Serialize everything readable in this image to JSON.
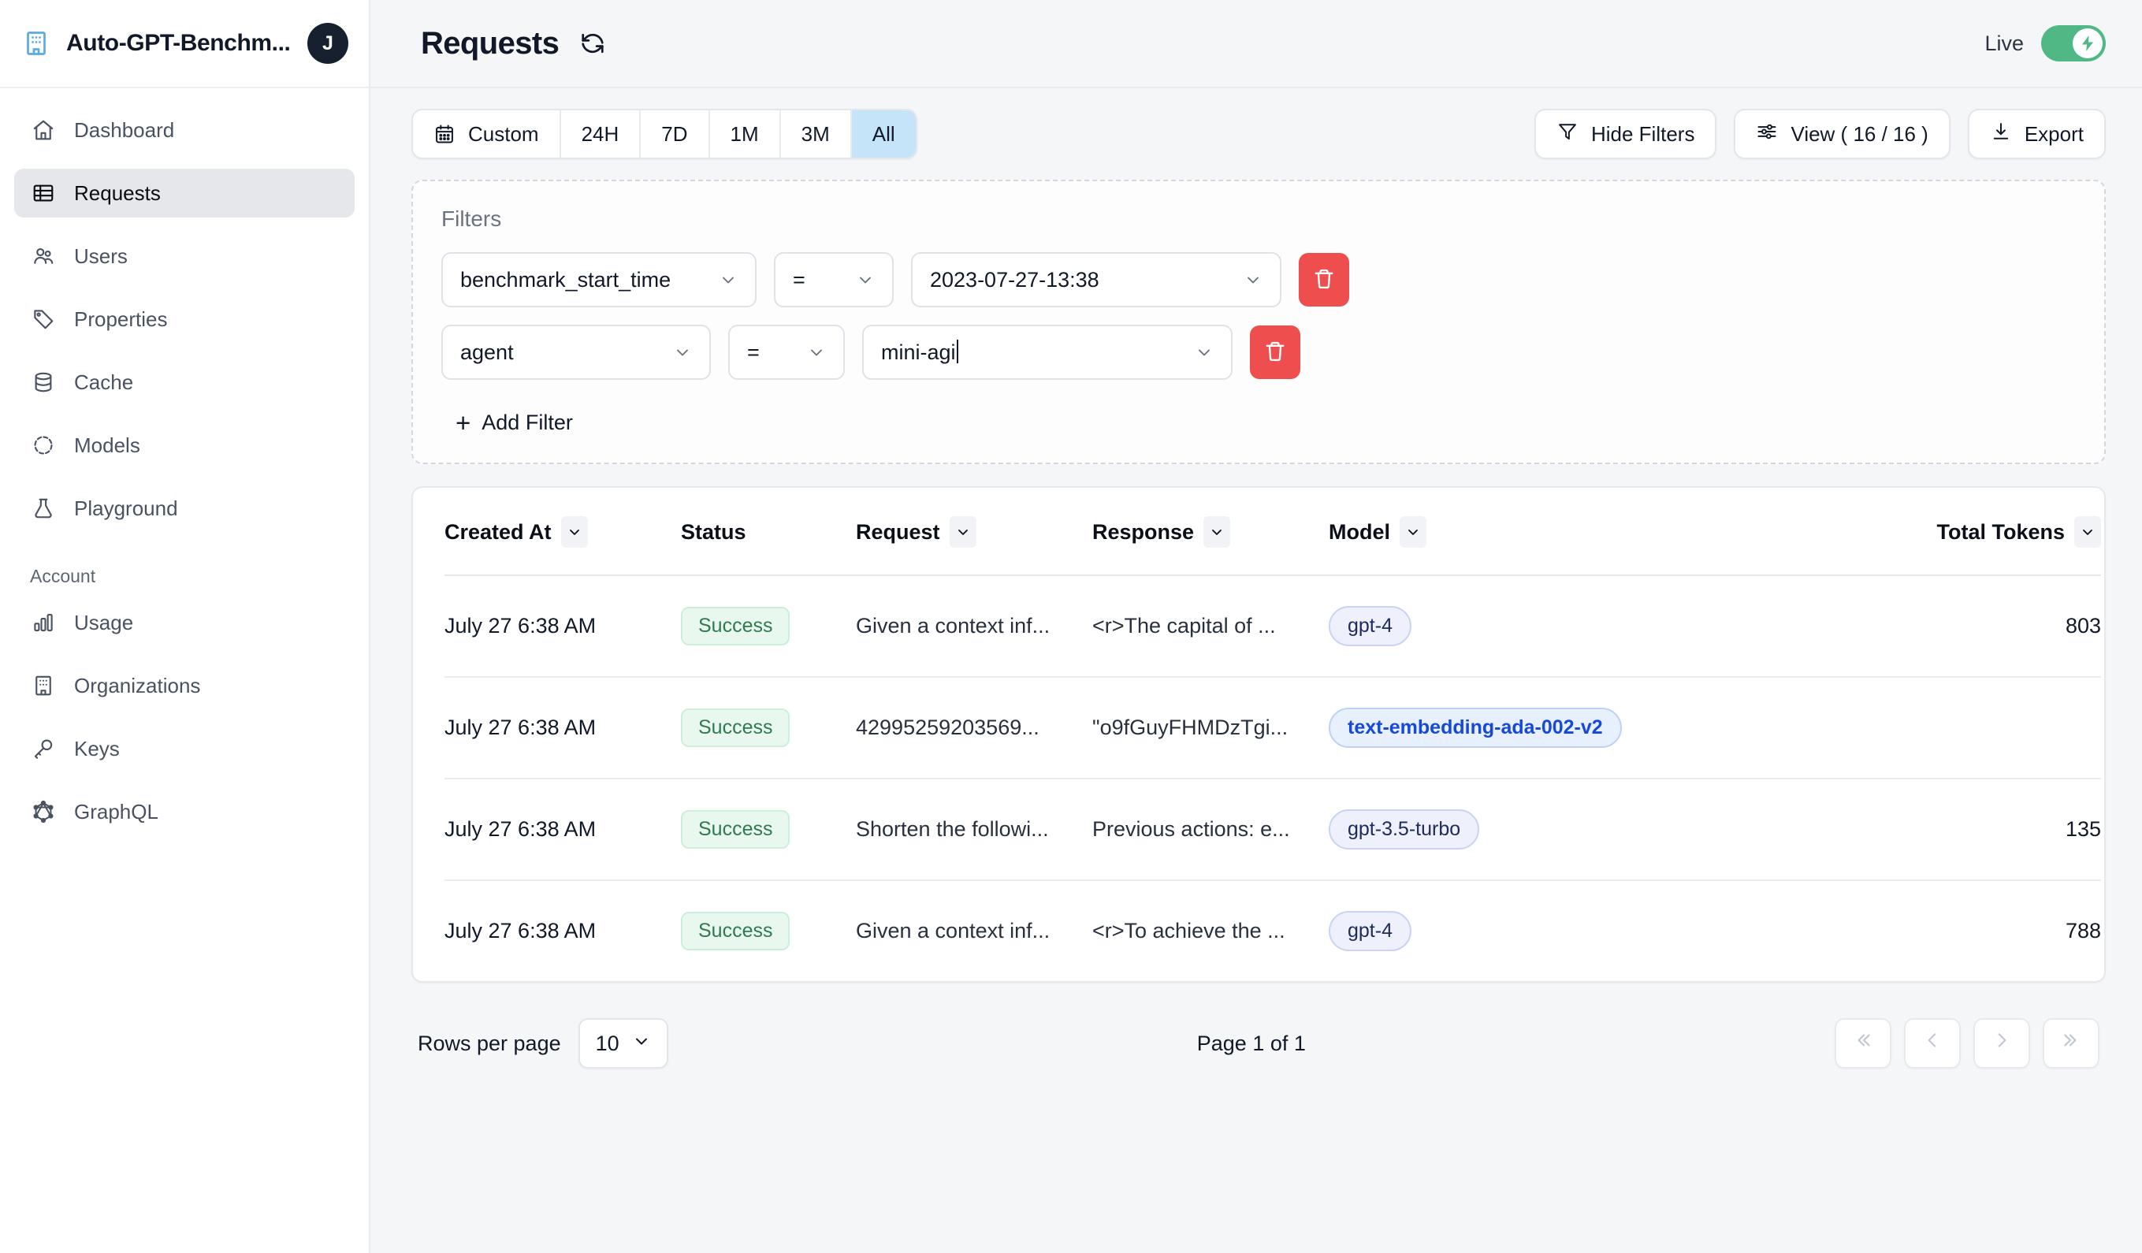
{
  "sidebar": {
    "org": {
      "name": "Auto-GPT-Benchm...",
      "avatar_initial": "J",
      "icon": "building-icon"
    },
    "items": [
      {
        "label": "Dashboard",
        "icon": "home-icon",
        "active": false
      },
      {
        "label": "Requests",
        "icon": "table-icon",
        "active": true
      },
      {
        "label": "Users",
        "icon": "users-icon",
        "active": false
      },
      {
        "label": "Properties",
        "icon": "tag-icon",
        "active": false
      },
      {
        "label": "Cache",
        "icon": "database-icon",
        "active": false
      },
      {
        "label": "Models",
        "icon": "cube-icon",
        "active": false
      },
      {
        "label": "Playground",
        "icon": "beaker-icon",
        "active": false
      }
    ],
    "account_label": "Account",
    "account_items": [
      {
        "label": "Usage",
        "icon": "bar-chart-icon"
      },
      {
        "label": "Organizations",
        "icon": "building-icon"
      },
      {
        "label": "Keys",
        "icon": "key-icon"
      },
      {
        "label": "GraphQL",
        "icon": "graphql-icon"
      }
    ]
  },
  "header": {
    "title": "Requests",
    "refresh_icon": "refresh-icon",
    "live_label": "Live",
    "live_on": true
  },
  "toolbar": {
    "time_ranges": [
      {
        "label": "Custom",
        "icon": "calendar-icon",
        "selected": false
      },
      {
        "label": "24H",
        "selected": false
      },
      {
        "label": "7D",
        "selected": false
      },
      {
        "label": "1M",
        "selected": false
      },
      {
        "label": "3M",
        "selected": false
      },
      {
        "label": "All",
        "selected": true
      }
    ],
    "hide_filters_label": "Hide Filters",
    "view_label": "View ( 16 / 16 )",
    "export_label": "Export"
  },
  "filters": {
    "title": "Filters",
    "rows": [
      {
        "field": "benchmark_start_time",
        "operator": "=",
        "value": "2023-07-27-13:38",
        "focused": false
      },
      {
        "field": "agent",
        "operator": "=",
        "value": "mini-agi",
        "focused": true
      }
    ],
    "add_filter_label": "Add Filter",
    "delete_icon": "trash-icon"
  },
  "table": {
    "columns": [
      {
        "label": "Created At",
        "sortable": true
      },
      {
        "label": "Status",
        "sortable": false
      },
      {
        "label": "Request",
        "sortable": true
      },
      {
        "label": "Response",
        "sortable": true
      },
      {
        "label": "Model",
        "sortable": true
      },
      {
        "label": "Total Tokens",
        "sortable": true
      }
    ],
    "rows": [
      {
        "created_at": "July 27 6:38 AM",
        "status": "Success",
        "request": "Given a context inf...",
        "response": "<r>The capital of ...",
        "model": "gpt-4",
        "model_style": "default",
        "total_tokens": "803"
      },
      {
        "created_at": "July 27 6:38 AM",
        "status": "Success",
        "request": "42995259203569...",
        "response": "\"o9fGuyFHMDzTgi...",
        "model": "text-embedding-ada-002-v2",
        "model_style": "embedding",
        "total_tokens": ""
      },
      {
        "created_at": "July 27 6:38 AM",
        "status": "Success",
        "request": "Shorten the followi...",
        "response": "Previous actions: e...",
        "model": "gpt-3.5-turbo",
        "model_style": "default",
        "total_tokens": "135"
      },
      {
        "created_at": "July 27 6:38 AM",
        "status": "Success",
        "request": "Given a context inf...",
        "response": "<r>To achieve the ...",
        "model": "gpt-4",
        "model_style": "default",
        "total_tokens": "788"
      }
    ]
  },
  "pagination": {
    "rows_per_page_label": "Rows per page",
    "rows_per_page_value": "10",
    "page_info": "Page 1 of 1",
    "first_icon": "chevron-double-left-icon",
    "prev_icon": "chevron-left-icon",
    "next_icon": "chevron-right-icon",
    "last_icon": "chevron-double-right-icon"
  },
  "colors": {
    "accent_blue": "#c5e4fa",
    "org_icon_blue": "#5aabe0",
    "live_green": "#4fb884",
    "success_text": "#2f7a4e",
    "success_bg": "#e9f8ee",
    "model_badge_bg": "#eef0fb",
    "embedding_text": "#1649d8",
    "delete_red": "#ef4e4e",
    "sidebar_active_bg": "#e5e7eb"
  }
}
